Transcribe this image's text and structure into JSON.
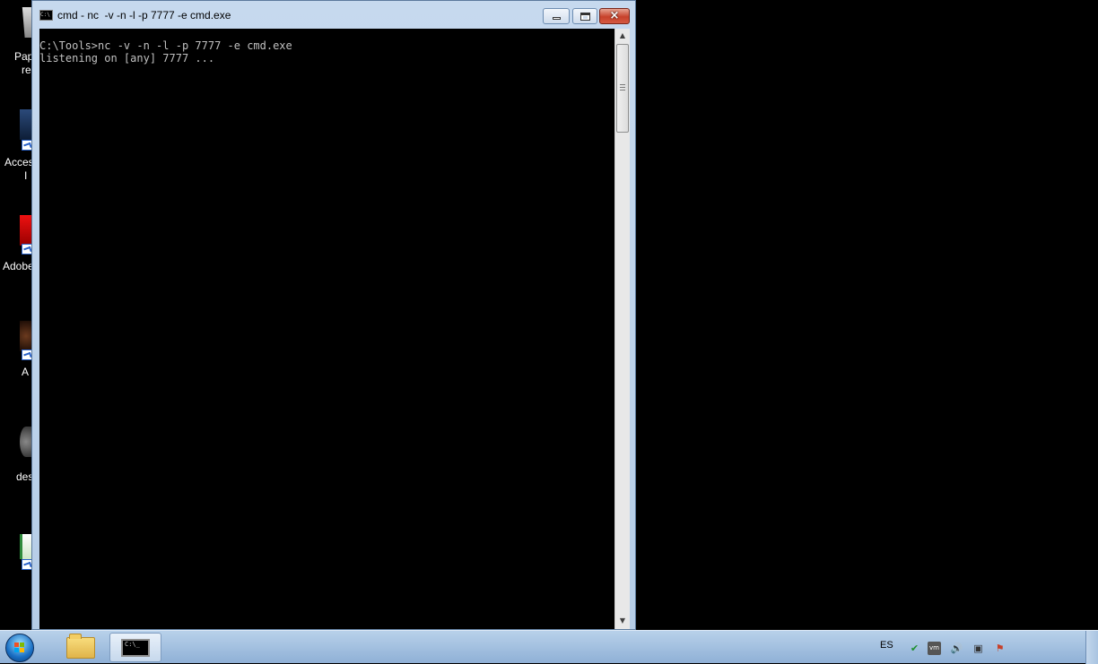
{
  "desktop": {
    "icons": [
      {
        "icon": "recycle-bin-icon",
        "label_line1": "Pap",
        "label_line2": "re"
      },
      {
        "icon": "app-shortcut-icon",
        "label_line1": "Acces",
        "label_line2": "I"
      },
      {
        "icon": "adobe-shortcut-icon",
        "label_line1": "Adobe",
        "label_line2": ""
      },
      {
        "icon": "app-shortcut-icon",
        "label_line1": "A",
        "label_line2": ""
      },
      {
        "icon": "gear-shortcut-icon",
        "label_line1": "des",
        "label_line2": ""
      },
      {
        "icon": "document-shortcut-icon",
        "label_line1": "",
        "label_line2": ""
      }
    ]
  },
  "window": {
    "title": "cmd - nc  -v -n -l -p 7777 -e cmd.exe",
    "icon": "console-icon",
    "controls": {
      "minimize": "minimize-icon",
      "maximize": "maximize-icon",
      "close": "×"
    },
    "console_lines": [
      "C:\\Tools>nc -v -n -l -p 7777 -e cmd.exe",
      "listening on [any] 7777 ..."
    ],
    "scrollbar": {
      "up": "▲",
      "down": "▼"
    }
  },
  "taskbar": {
    "start": "windows-start-icon",
    "buttons": [
      {
        "icon": "folder-icon"
      },
      {
        "icon": "console-icon",
        "text": "C:\\_"
      }
    ],
    "language": "ES",
    "tray": [
      "security-shield-icon",
      "vmware-icon",
      "volume-icon",
      "network-icon",
      "action-center-icon"
    ],
    "colors": {
      "accent": "#2a62c9",
      "close_red": "#c7412a"
    }
  }
}
